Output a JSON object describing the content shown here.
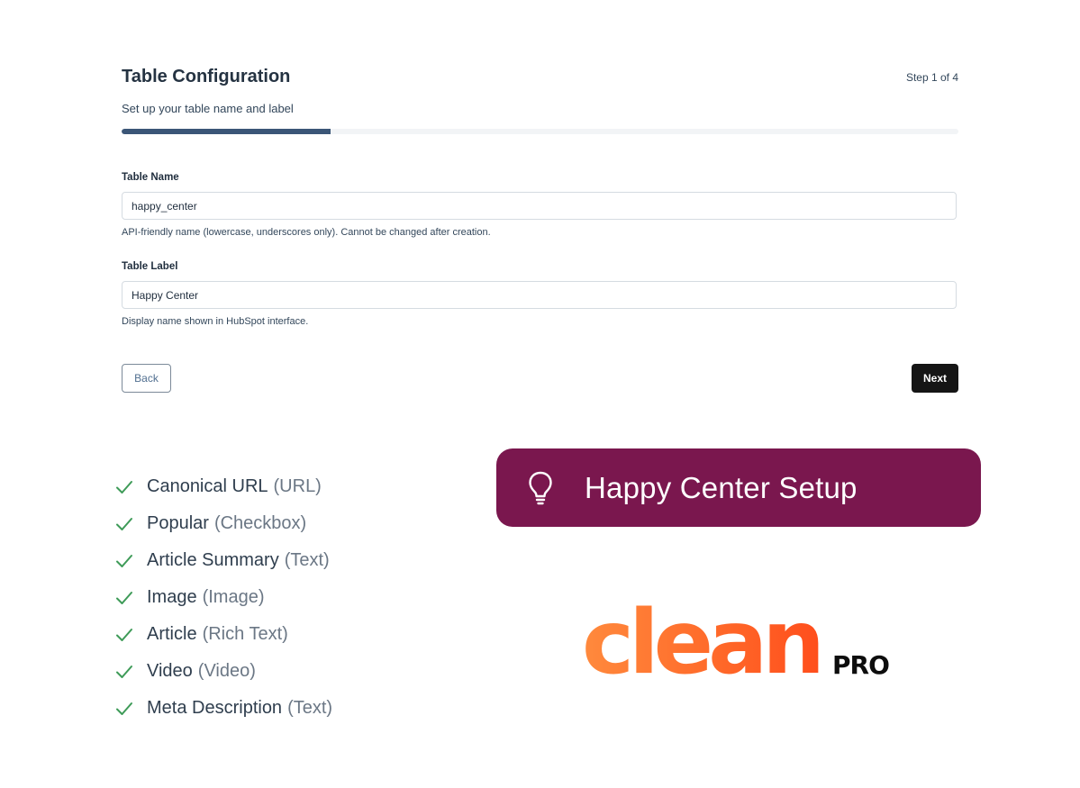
{
  "form": {
    "title": "Table Configuration",
    "step": "Step 1 of 4",
    "subtitle": "Set up your table name and label",
    "progress_fraction": 0.25,
    "colors": {
      "progress": "#3b5677",
      "track": "#f2f4f6"
    },
    "table_name": {
      "label": "Table Name",
      "value": "happy_center",
      "help": "API-friendly name (lowercase, underscores only). Cannot be changed after creation."
    },
    "table_label": {
      "label": "Table Label",
      "value": "Happy Center",
      "help": "Display name shown in HubSpot interface."
    },
    "back_label": "Back",
    "next_label": "Next"
  },
  "checklist": {
    "icon": "check-icon",
    "check_color": "#3e9b58",
    "items": [
      {
        "name": "Canonical URL",
        "type": "(URL)"
      },
      {
        "name": "Popular",
        "type": "(Checkbox)"
      },
      {
        "name": "Article Summary",
        "type": "(Text)"
      },
      {
        "name": "Image",
        "type": "(Image)"
      },
      {
        "name": "Article",
        "type": "(Rich Text)"
      },
      {
        "name": "Video",
        "type": "(Video)"
      },
      {
        "name": "Meta Description",
        "type": "(Text)"
      }
    ]
  },
  "banner": {
    "icon": "lightbulb-icon",
    "text": "Happy Center Setup",
    "color": "#7a174e"
  },
  "logo": {
    "main": "clean",
    "suffix": "PRO",
    "color": "#ff6a2a"
  }
}
